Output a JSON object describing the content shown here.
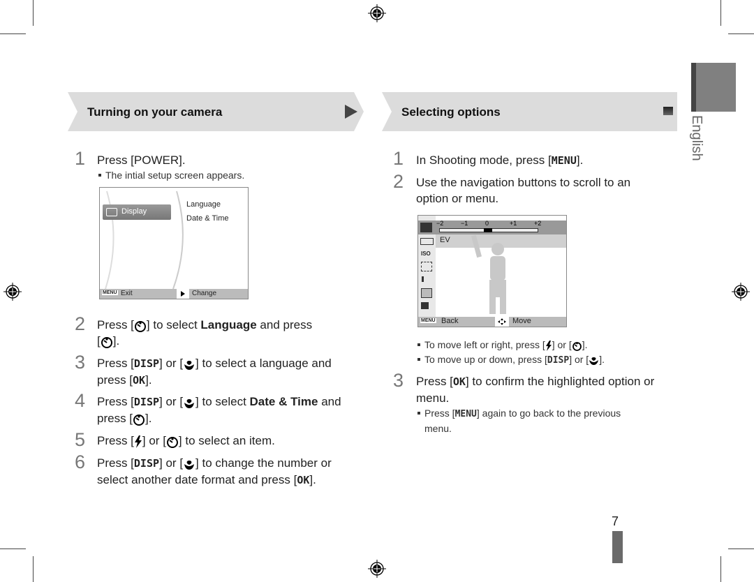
{
  "side_tab": {
    "language": "English"
  },
  "page_number": "7",
  "left_section": {
    "title": "Turning on your camera",
    "steps": [
      {
        "num": "1",
        "text_pre": "Press [",
        "key": "POWER",
        "text_post": "]."
      },
      {
        "num": "2",
        "line1_pre": "Press [",
        "icon": "timer-icon",
        "line1_mid": "] to select ",
        "bold": "Language",
        "line1_post": " and press",
        "line2": "]."
      },
      {
        "num": "3",
        "pre": "Press [",
        "key1": "DISP",
        "mid1": "] or [",
        "mid2": "] to select a language and",
        "line2_pre": "press [",
        "key2": "OK",
        "line2_post": "]."
      },
      {
        "num": "4",
        "pre": "Press [",
        "key1": "DISP",
        "mid1": "] or [",
        "mid2": "] to select ",
        "bold": "Date & Time",
        "post": " and",
        "line2_pre": "press [",
        "line2_post": "]."
      },
      {
        "num": "5",
        "pre": "Press [",
        "mid": "] or [",
        "post": "] to select an item."
      },
      {
        "num": "6",
        "pre": "Press [",
        "key1": "DISP",
        "mid1": "] or [",
        "mid2": "] to change the number or",
        "line2_pre": "select another date format and press [",
        "key2": "OK",
        "line2_post": "]."
      }
    ],
    "bullet": "The intial setup screen appears.",
    "setup_screen": {
      "menu_item": "Display",
      "options": [
        "Language",
        "Date & Time"
      ],
      "footer_left_key": "MENU",
      "footer_left": "Exit",
      "footer_right": "Change"
    }
  },
  "right_section": {
    "title": "Selecting options",
    "steps": [
      {
        "num": "1",
        "pre": "In Shooting mode, press [",
        "key": "MENU",
        "post": "]."
      },
      {
        "num": "2",
        "line1": "Use the navigation buttons to scroll to an",
        "line2": "option or menu."
      },
      {
        "num": "3",
        "pre": "Press [",
        "key": "OK",
        "post": "] to confirm the highlighted option or",
        "line2": "menu."
      }
    ],
    "bullets_step2": [
      {
        "pre": "To move left or right, press [",
        "mid": "] or [",
        "post": "]."
      },
      {
        "pre": "To move up or down, press [",
        "key": "DISP",
        "mid": "] or [",
        "post": "]."
      }
    ],
    "bullet_step3": {
      "pre": "Press [",
      "key": "MENU",
      "post": "] again to go back to the previous",
      "line2": "menu."
    },
    "ev_screen": {
      "scale": [
        "−2",
        "−1",
        "0",
        "+1",
        "+2"
      ],
      "selected_label": "EV",
      "ev_value": 0,
      "footer_left_key": "MENU",
      "footer_left": "Back",
      "footer_right": "Move"
    }
  }
}
